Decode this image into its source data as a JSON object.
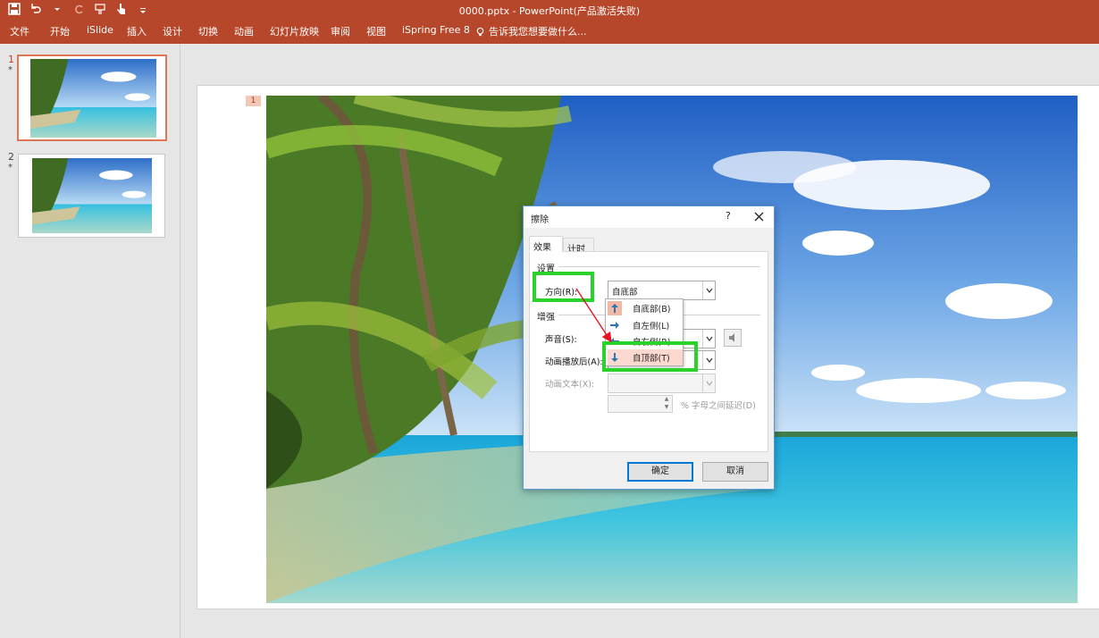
{
  "titlebar": {
    "title": "0000.pptx - PowerPoint(产品激活失败)",
    "qat": [
      "save-icon",
      "undo-icon",
      "redo-icon",
      "touch-mode-icon",
      "customize-icon"
    ]
  },
  "ribbon": {
    "tabs": [
      "文件",
      "开始",
      "iSlide",
      "插入",
      "设计",
      "切换",
      "动画",
      "幻灯片放映",
      "审阅",
      "视图",
      "iSpring Free 8"
    ],
    "tell_me": "告诉我您想要做什么..."
  },
  "thumbnails": [
    {
      "number": "1",
      "star": "*"
    },
    {
      "number": "2",
      "star": "*"
    }
  ],
  "slide": {
    "anim_tag": "1"
  },
  "dialog": {
    "title": "擦除",
    "help": "?",
    "tabs": [
      "效果",
      "计时"
    ],
    "section_settings": "设置",
    "direction_label": "方向(R):",
    "direction_value": "自底部",
    "section_enhance": "增强",
    "sound_label": "声音(S):",
    "after_anim_label": "动画播放后(A):",
    "anim_text_label": "动画文本(X):",
    "delay_suffix": "% 字母之间延迟(D)",
    "dropdown_items": [
      "自底部(B)",
      "自左侧(L)",
      "自右侧(R)",
      "自顶部(T)"
    ],
    "ok": "确定",
    "cancel": "取消"
  },
  "colors": {
    "ribbon": "#b7472a",
    "highlight": "#2bd22b",
    "selected_thumb": "#e07653"
  }
}
